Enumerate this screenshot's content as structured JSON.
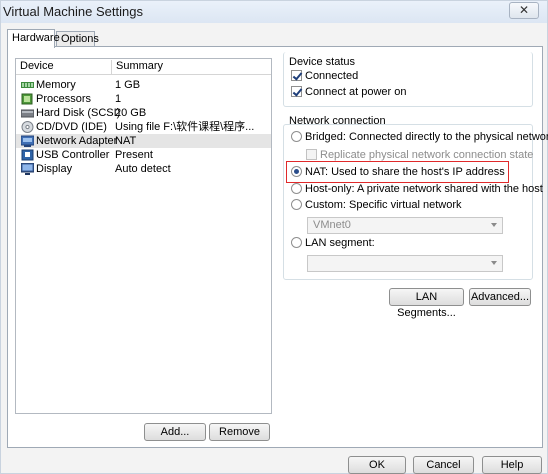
{
  "window": {
    "title": "Virtual Machine Settings",
    "close_glyph": "✕"
  },
  "tabs": [
    {
      "label": "Hardware"
    },
    {
      "label": "Options"
    }
  ],
  "device_list": {
    "columns": [
      "Device",
      "Summary"
    ],
    "rows": [
      {
        "name": "Memory",
        "summary": "1 GB",
        "icon": "memory-icon"
      },
      {
        "name": "Processors",
        "summary": "1",
        "icon": "processor-icon"
      },
      {
        "name": "Hard Disk (SCSI)",
        "summary": "20 GB",
        "icon": "hard-disk-icon"
      },
      {
        "name": "CD/DVD (IDE)",
        "summary": "Using file F:\\软件课程\\程序...",
        "icon": "cd-dvd-icon"
      },
      {
        "name": "Network Adapter",
        "summary": "NAT",
        "icon": "network-adapter-icon"
      },
      {
        "name": "USB Controller",
        "summary": "Present",
        "icon": "usb-icon"
      },
      {
        "name": "Display",
        "summary": "Auto detect",
        "icon": "display-icon"
      }
    ],
    "selected_index": 4
  },
  "buttons": {
    "add": "Add...",
    "remove": "Remove",
    "lan_segments": "LAN Segments...",
    "advanced": "Advanced...",
    "ok": "OK",
    "cancel": "Cancel",
    "help": "Help"
  },
  "device_status": {
    "label": "Device status",
    "connected": {
      "label": "Connected",
      "checked": true
    },
    "connect_at_power_on": {
      "label": "Connect at power on",
      "checked": true
    }
  },
  "network_connection": {
    "label": "Network connection",
    "bridged": "Bridged: Connected directly to the physical network",
    "replicate": "Replicate physical network connection state",
    "nat": "NAT: Used to share the host's IP address",
    "host_only": "Host-only: A private network shared with the host",
    "custom": "Custom: Specific virtual network",
    "custom_value": "VMnet0",
    "lan_segment": "LAN segment:",
    "lan_segment_value": "",
    "selected": "nat"
  },
  "colors": {
    "highlight_border": "#e0292a",
    "selected_row": "#e5e5e5",
    "title_gradient": "#dce6f3"
  }
}
